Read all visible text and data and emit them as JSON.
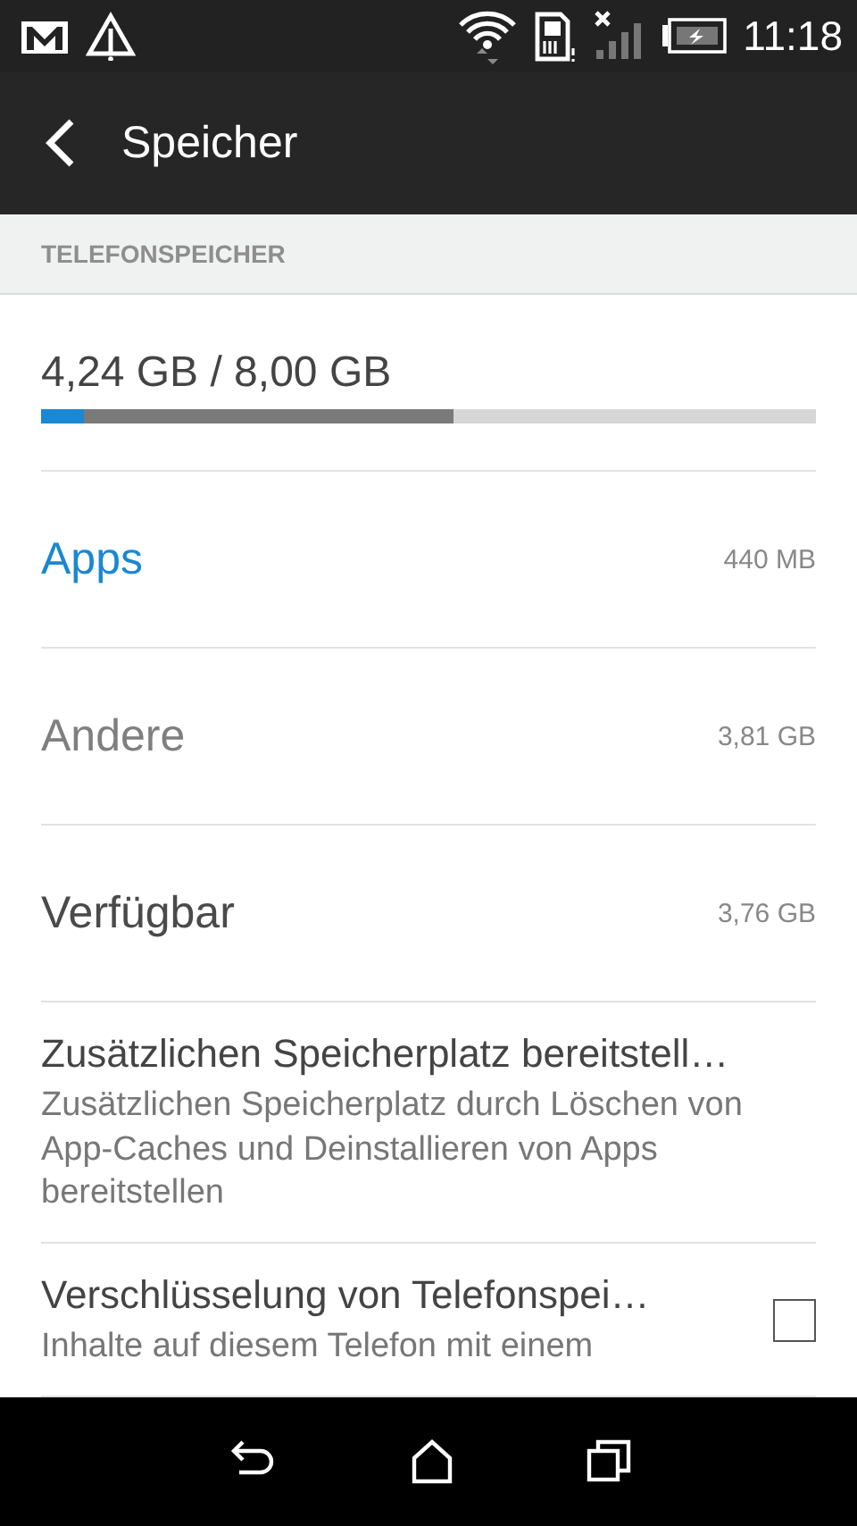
{
  "status_bar": {
    "time": "11:18"
  },
  "app_bar": {
    "title": "Speicher"
  },
  "section": {
    "title": "TELEFONSPEICHER"
  },
  "storage": {
    "usage": "4,24 GB / 8,00 GB",
    "segments": [
      {
        "level": 0.055,
        "color": "#1a88d2"
      },
      {
        "level": 0.532,
        "color": "#7a7a7a"
      }
    ]
  },
  "rows": [
    {
      "title": "Apps",
      "value": "440 MB",
      "color": "#1a88d2"
    },
    {
      "title": "Andere",
      "value": "3,81 GB",
      "color": "#7f7f7f"
    },
    {
      "title": "Verfügbar",
      "value": "3,76 GB",
      "color": "#4a4a4a"
    }
  ],
  "settings": [
    {
      "kind": "action",
      "title": "Zusätzlichen Speicherplatz bereitstell…",
      "summary": "Zusätzlichen Speicherplatz durch Löschen von App-Caches und Deinstallieren von Apps bereitstellen"
    },
    {
      "kind": "checkbox",
      "title": "Verschlüsselung von Telefonspei…",
      "summary": "Inhalte auf diesem Telefon mit einem",
      "checked": false
    }
  ]
}
